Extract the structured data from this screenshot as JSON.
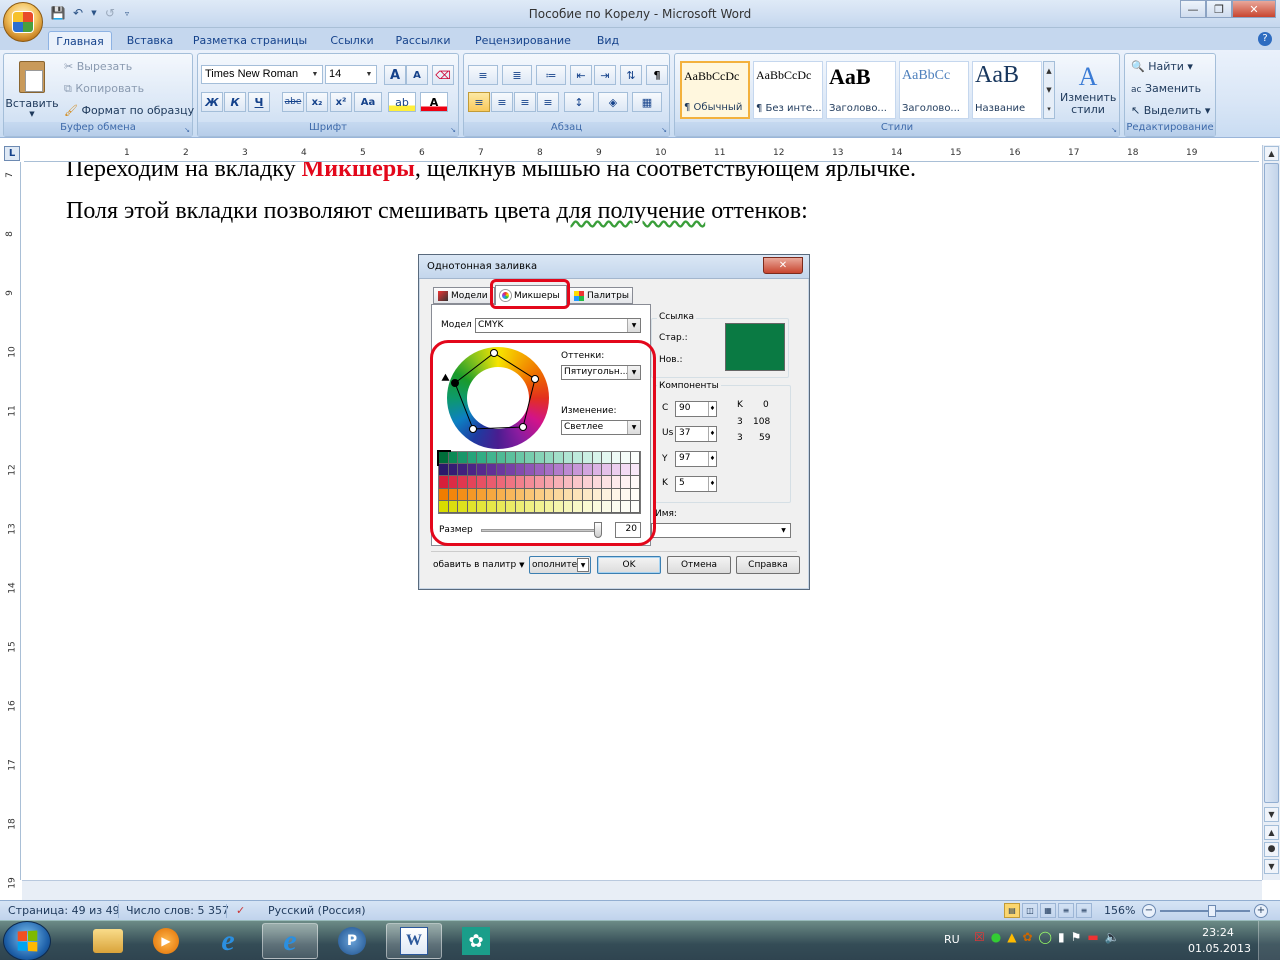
{
  "window": {
    "title": "Пособие по Корелу - Microsoft Word"
  },
  "tabs": [
    "Главная",
    "Вставка",
    "Разметка страницы",
    "Ссылки",
    "Рассылки",
    "Рецензирование",
    "Вид"
  ],
  "active_tab": "Главная",
  "ribbon": {
    "clipboard": {
      "paste_label": "Вставить",
      "cut_label": "Вырезать",
      "copy_label": "Копировать",
      "format_painter_label": "Формат по образцу",
      "group_label": "Буфер обмена"
    },
    "font": {
      "font_name": "Times New Roman",
      "font_size": "14",
      "grow": "A",
      "shrink": "A",
      "bold": "Ж",
      "italic": "К",
      "underline": "Ч",
      "strike": "abe",
      "subscript": "x₂",
      "superscript": "x²",
      "change_case": "Aa",
      "group_label": "Шрифт"
    },
    "paragraph": {
      "pilcrow": "¶",
      "group_label": "Абзац"
    },
    "styles": {
      "items": [
        {
          "preview": "AaBbCcDc",
          "name": "¶ Обычный"
        },
        {
          "preview": "AaBbCcDc",
          "name": "¶ Без инте..."
        },
        {
          "preview": "AaB",
          "name": "Заголово..."
        },
        {
          "preview": "AaBbCc",
          "name": "Заголово..."
        },
        {
          "preview": "AaB",
          "name": "Название"
        }
      ],
      "change_styles_label": "Изменить стили",
      "group_label": "Стили"
    },
    "editing": {
      "find_label": "Найти",
      "replace_label": "Заменить",
      "select_label": "Выделить",
      "group_label": "Редактирование"
    }
  },
  "ruler": {
    "numbers": [
      "1",
      "2",
      "3",
      "4",
      "5",
      "6",
      "7",
      "8",
      "9",
      "10",
      "11",
      "12",
      "13",
      "14",
      "15",
      "16",
      "17",
      "18",
      "19"
    ],
    "vnumbers": [
      "7",
      "8",
      "9",
      "10",
      "11",
      "12",
      "13",
      "14",
      "15",
      "16",
      "17",
      "18",
      "19"
    ]
  },
  "document": {
    "line1_before": "Переходим на вкладку ",
    "line1_highlight": "Микшеры",
    "line1_after": ", щелкнув мышью на соответствующем ярлычке.",
    "line2_before": "Поля этой вкладки позволяют смешивать цвета ",
    "line2_squiggly": "для получение",
    "line2_after": " оттенков:"
  },
  "dialog": {
    "title": "Однотонная заливка",
    "tabs": [
      "Модели",
      "Микшеры",
      "Палитры"
    ],
    "model_label": "Модел",
    "model_value": "CMYK",
    "hues_label": "Оттенки:",
    "hues_value": "Пятиугольн...",
    "change_label": "Изменение:",
    "change_value": "Светлее",
    "size_label": "Размер",
    "size_value": "20",
    "ref_label": "Ссылка",
    "old_label": "Стар.:",
    "new_label": "Нов.:",
    "old_color": "#0a7a43",
    "components_label": "Компоненты",
    "components": [
      {
        "label": "C",
        "value": "90"
      },
      {
        "label": "Us",
        "value": "37"
      },
      {
        "label": "Y",
        "value": "97"
      },
      {
        "label": "K",
        "value": "5"
      }
    ],
    "rgb": [
      {
        "label": "K",
        "value": "0"
      },
      {
        "label": "3",
        "value": "108"
      },
      {
        "label": "3",
        "value": "59"
      }
    ],
    "name_label": "Имя:",
    "add_palette": "обавить в палитр",
    "more": "ополнитель",
    "ok": "OK",
    "cancel": "Отмена",
    "help": "Справка",
    "grid_rows": [
      [
        "#006f3a",
        "#0a8a55",
        "#19976a",
        "#26a47a",
        "#32ad84",
        "#41b58f",
        "#4fba95",
        "#5cc09d",
        "#6ac7a6",
        "#77cdae",
        "#86d3b7",
        "#93d9c0",
        "#a2dfc9",
        "#b0e5d3",
        "#beead c",
        "#cbefe3",
        "#d7f3ea",
        "#e3f7f0",
        "#eefaf6",
        "#f5fcf9",
        "#fbfefc"
      ],
      [
        "#2c1a6b",
        "#361c74",
        "#41207d",
        "#4c2486",
        "#572a8e",
        "#623096",
        "#6d389e",
        "#7841a6",
        "#844bae",
        "#8f56b6",
        "#9b62bd",
        "#a66ec4",
        "#b27bcb",
        "#bd89d2",
        "#c897d8",
        "#d2a5df",
        "#dcb3e5",
        "#e5c1ea",
        "#ecceef",
        "#f3dbf4",
        "#f8e8f8"
      ],
      [
        "#d71f3a",
        "#dc2b45",
        "#e0374f",
        "#e44459",
        "#e75063",
        "#ea5c6e",
        "#ed6878",
        "#ef7482",
        "#f1808c",
        "#f38c97",
        "#f598a1",
        "#f7a4ab",
        "#f8b0b6",
        "#f9bbc0",
        "#fac6ca",
        "#fbd0d4",
        "#fcd9dc",
        "#fde2e4",
        "#fdeaec",
        "#fef1f2",
        "#fef8f8"
      ],
      [
        "#f07d00",
        "#f2860c",
        "#f38f19",
        "#f49826",
        "#f5a033",
        "#f6a840",
        "#f7b04e",
        "#f8b75b",
        "#f8be68",
        "#f9c575",
        "#facc83",
        "#fad290",
        "#fbd89d",
        "#fbdeab",
        "#fce3b8",
        "#fce8c5",
        "#fdedd2",
        "#fdf1de",
        "#fef5e8",
        "#fef8f0",
        "#fffcf8"
      ],
      [
        "#d8dc00",
        "#dbde0f",
        "#dee11d",
        "#e1e32b",
        "#e4e53a",
        "#e6e748",
        "#e9e957",
        "#ebeb65",
        "#eded73",
        "#efef82",
        "#f1f190",
        "#f3f39e",
        "#f5f5ac",
        "#f6f6b9",
        "#f8f8c6",
        "#f9f9d2",
        "#fafadd",
        "#fbfbe7",
        "#fcfcef",
        "#fdfdf5",
        "#fefefa"
      ]
    ]
  },
  "status": {
    "page": "Страница: 49 из 49",
    "words": "Число слов: 5 357",
    "lang": "Русский (Россия)",
    "zoom": "156%"
  },
  "taskbar": {
    "lang": "RU",
    "time": "23:24",
    "date": "01.05.2013"
  }
}
